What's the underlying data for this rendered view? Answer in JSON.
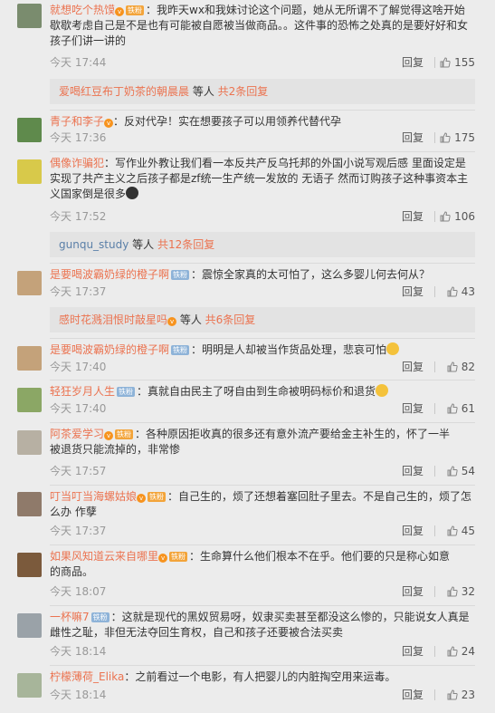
{
  "comments": [
    {
      "user": "就想吃个热馍",
      "badge": "铁粉",
      "vip": true,
      "text": [
        "：我昨天wx和我妹讨论这个问题，她从无所谓不了解觉得这啥开始",
        "歇歇考虑自己是不是也有可能被自愿被当做商品。。这件事的恐怖之处真的是要好好和女",
        "孩子们讲一讲的"
      ],
      "time": "今天 17:44",
      "reply": "回复",
      "likes": "155",
      "thread": {
        "user": "爱喝红豆布丁奶茶的朝晨晨",
        "text": " 等人 ",
        "count": "共2条回复"
      }
    },
    {
      "user": "青子和李子",
      "badge": "",
      "vip": true,
      "text": [
        "：反对代孕！实在想要孩子可以用领养代替代孕"
      ],
      "time": "今天 17:36",
      "reply": "回复",
      "likes": "175"
    },
    {
      "user": "偶像诈骗犯",
      "badge": "",
      "vip": false,
      "text": [
        "：写作业外教让我们看一本反共产反乌托邦的外国小说写观后感 里面设定是",
        "实现了共产主义之后孩子都是zf统一生产统一发放的 无语子 然而订购孩子这种事资本主",
        "义国家倒是很多"
      ],
      "time": "今天 17:52",
      "reply": "回复",
      "likes": "106",
      "thread": {
        "user": "gunqu_study",
        "text": " 等人 ",
        "count": "共12条回复"
      }
    },
    {
      "user": "是要喝波霸奶绿的橙子啊",
      "badge": "铁粉",
      "vip": false,
      "text": [
        "：震惊全家真的太可怕了，这么多婴儿何去何从？"
      ],
      "time": "今天 17:37",
      "reply": "回复",
      "likes": "43",
      "thread": {
        "user": "感时花溅泪恨时敲星吗",
        "text": " 等人 ",
        "count": "共6条回复"
      }
    },
    {
      "user": "是要喝波霸奶绿的橙子啊",
      "badge": "铁粉",
      "vip": false,
      "text": [
        "：明明是人却被当作货品处理，悲哀可怕"
      ],
      "time": "今天 17:40",
      "reply": "回复",
      "likes": "82"
    },
    {
      "user": "轻狂岁月人生",
      "badge": "铁粉",
      "vip": false,
      "text": [
        "：真就自由民主了呀自由到生命被明码标价和退货"
      ],
      "time": "今天 17:40",
      "reply": "回复",
      "likes": "61"
    },
    {
      "user": "阿茶爱学习",
      "badge": "铁粉",
      "vip": true,
      "text": [
        "：各种原因拒收真的很多还有意外流产要给金主补生的，怀了一半",
        "被退货只能流掉的，非常惨"
      ],
      "time": "今天 17:57",
      "reply": "回复",
      "likes": "54"
    },
    {
      "user": "叮当叮当海螺姑娘",
      "badge": "铁粉",
      "vip": true,
      "text": [
        "：自己生的，烦了还想着塞回肚子里去。不是自己生的，烦了怎",
        "么办 作孽"
      ],
      "time": "今天 17:37",
      "reply": "回复",
      "likes": "45"
    },
    {
      "user": "如果风知道云来自哪里",
      "badge": "铁粉",
      "vip": true,
      "text": [
        "：生命算什么他们根本不在乎。他们要的只是称心如意",
        "的商品。"
      ],
      "time": "今天 18:07",
      "reply": "回复",
      "likes": "32"
    },
    {
      "user": "一杯嘛7",
      "badge": "铁粉",
      "vip": false,
      "text": [
        "：这就是现代的黑奴贸易呀，奴隶买卖甚至都没这么惨的，只能说女人真是",
        "雌性之耻，非但无法夺回生育权，自己和孩子还要被合法买卖"
      ],
      "time": "今天 18:14",
      "reply": "回复",
      "likes": "24"
    },
    {
      "user": "柠檬薄荷_Elika",
      "badge": "",
      "vip": false,
      "text": [
        "：之前看过一个电影，有人把婴儿的内脏掏空用来运毒。"
      ],
      "time": "今天 18:14",
      "reply": "回复",
      "likes": "23"
    }
  ],
  "colors": {
    "username": "#eb7350",
    "meta": "#999999",
    "background": "#ececec"
  }
}
